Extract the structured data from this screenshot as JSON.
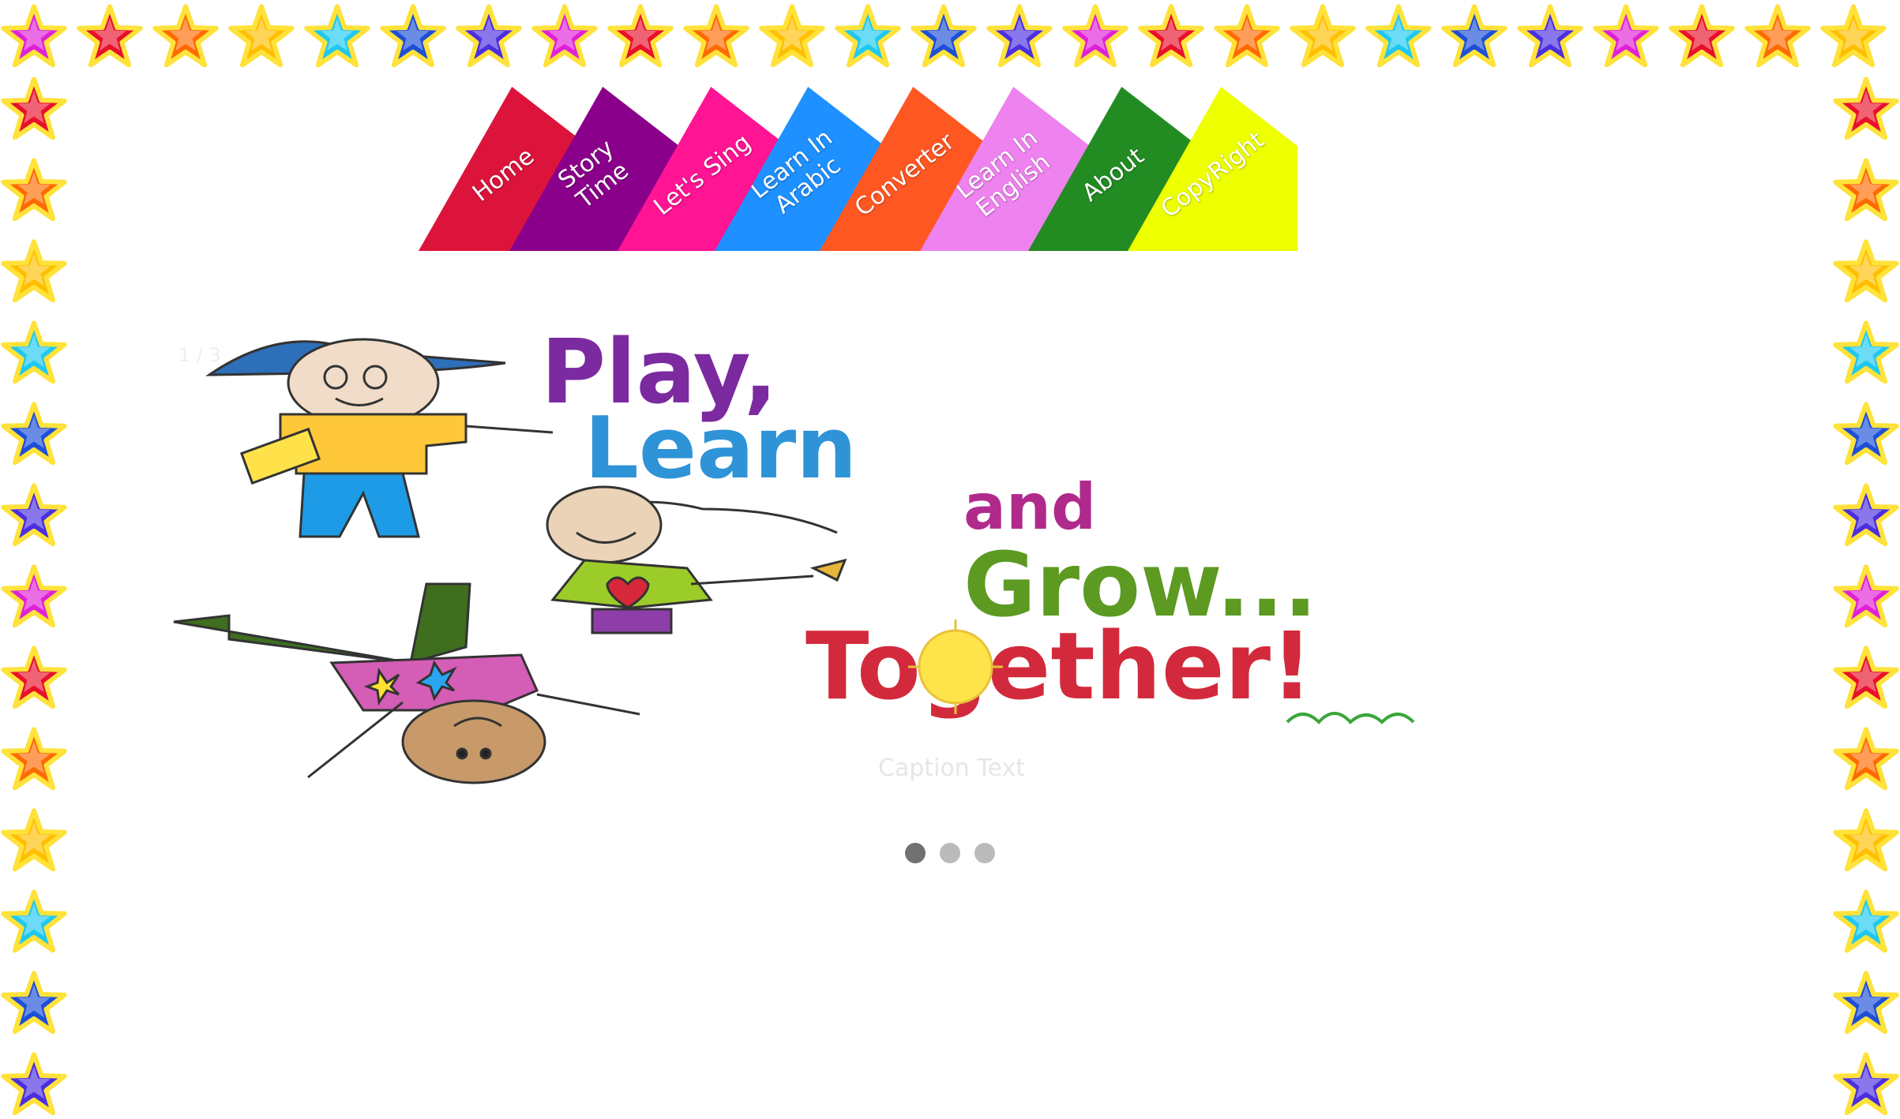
{
  "nav": {
    "items": [
      {
        "label": "Home",
        "color": "#dc143c"
      },
      {
        "label": "Story\nTime",
        "color": "#8b008b"
      },
      {
        "label": "Let's Sing",
        "color": "#ff1493"
      },
      {
        "label": "Learn In\nArabic",
        "color": "#1e90ff"
      },
      {
        "label": "Converter",
        "color": "#ff5722"
      },
      {
        "label": "Learn In\nEnglish",
        "color": "#ee82ee"
      },
      {
        "label": "About",
        "color": "#228b22"
      },
      {
        "label": "CopyRight",
        "color": "#eeff00"
      }
    ]
  },
  "slideshow": {
    "counter": "1 / 3",
    "caption": "Caption Text",
    "banner": {
      "line1": "Play,",
      "line2": "Learn",
      "line3": "and",
      "line4": "Grow...",
      "line5": "Together!"
    },
    "dots": [
      {
        "active": true
      },
      {
        "active": false
      },
      {
        "active": false
      }
    ]
  },
  "border": {
    "star_colors": [
      "#e020d8",
      "#e8102a",
      "#ff6a00",
      "#ffbf00",
      "#1ec8f0",
      "#1d4fd8",
      "#4a2ee0"
    ]
  }
}
